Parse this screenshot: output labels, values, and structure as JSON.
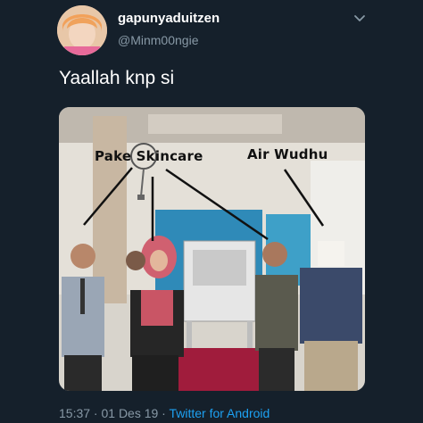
{
  "tweet": {
    "display_name": "gapunyaduitzen",
    "handle": "@Minm00ngie",
    "text": "Yaallah knp si",
    "timestamp": "15:37 · 01 Des 19 · ",
    "source": "Twitter for Android"
  },
  "media": {
    "caption_left": "Pake Skincare",
    "caption_right": "Air Wudhu"
  },
  "icons": {
    "menu": "chevron-down-icon"
  },
  "colors": {
    "background": "#15202b",
    "secondary_text": "#8899a6",
    "link": "#1da1f2"
  }
}
